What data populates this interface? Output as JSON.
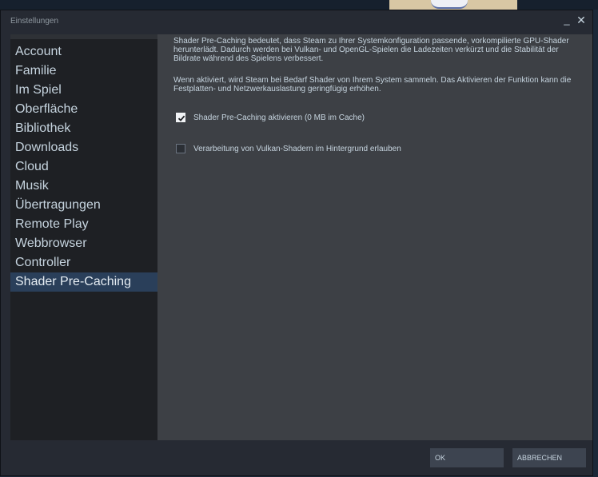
{
  "window": {
    "title": "Einstellungen",
    "minimize_label": "_",
    "close_label": "✕"
  },
  "sidebar": {
    "items": [
      {
        "label": "Account"
      },
      {
        "label": "Familie"
      },
      {
        "label": "Im Spiel"
      },
      {
        "label": "Oberfläche"
      },
      {
        "label": "Bibliothek"
      },
      {
        "label": "Downloads"
      },
      {
        "label": "Cloud"
      },
      {
        "label": "Musik"
      },
      {
        "label": "Übertragungen"
      },
      {
        "label": "Remote Play"
      },
      {
        "label": "Webbrowser"
      },
      {
        "label": "Controller"
      },
      {
        "label": "Shader Pre-Caching",
        "selected": true
      }
    ]
  },
  "content": {
    "paragraph1": "Shader Pre-Caching bedeutet, dass Steam zu Ihrer Systemkonfiguration passende, vorkompilierte GPU-Shader herunterlädt. Dadurch werden bei Vulkan- und OpenGL-Spielen die Ladezeiten verkürzt und die Stabilität der Bildrate während des Spielens verbessert.",
    "paragraph2": "Wenn aktiviert, wird Steam bei Bedarf Shader von Ihrem System sammeln. Das Aktivieren der Funktion kann die Festplatten- und Netzwerkauslastung geringfügig erhöhen.",
    "options": [
      {
        "label": "Shader Pre-Caching aktivieren (0 MB im Cache)",
        "checked": true
      },
      {
        "label": "Verarbeitung von Vulkan-Shadern im Hintergrund erlauben",
        "checked": false
      }
    ]
  },
  "footer": {
    "ok_label": "OK",
    "cancel_label": "ABBRECHEN"
  },
  "colors": {
    "window_bg": "#262a33",
    "sidebar_bg": "#1e2024",
    "content_bg": "#3d4045",
    "selected_bg": "#2a3f5a",
    "text": "#c6d4df"
  }
}
